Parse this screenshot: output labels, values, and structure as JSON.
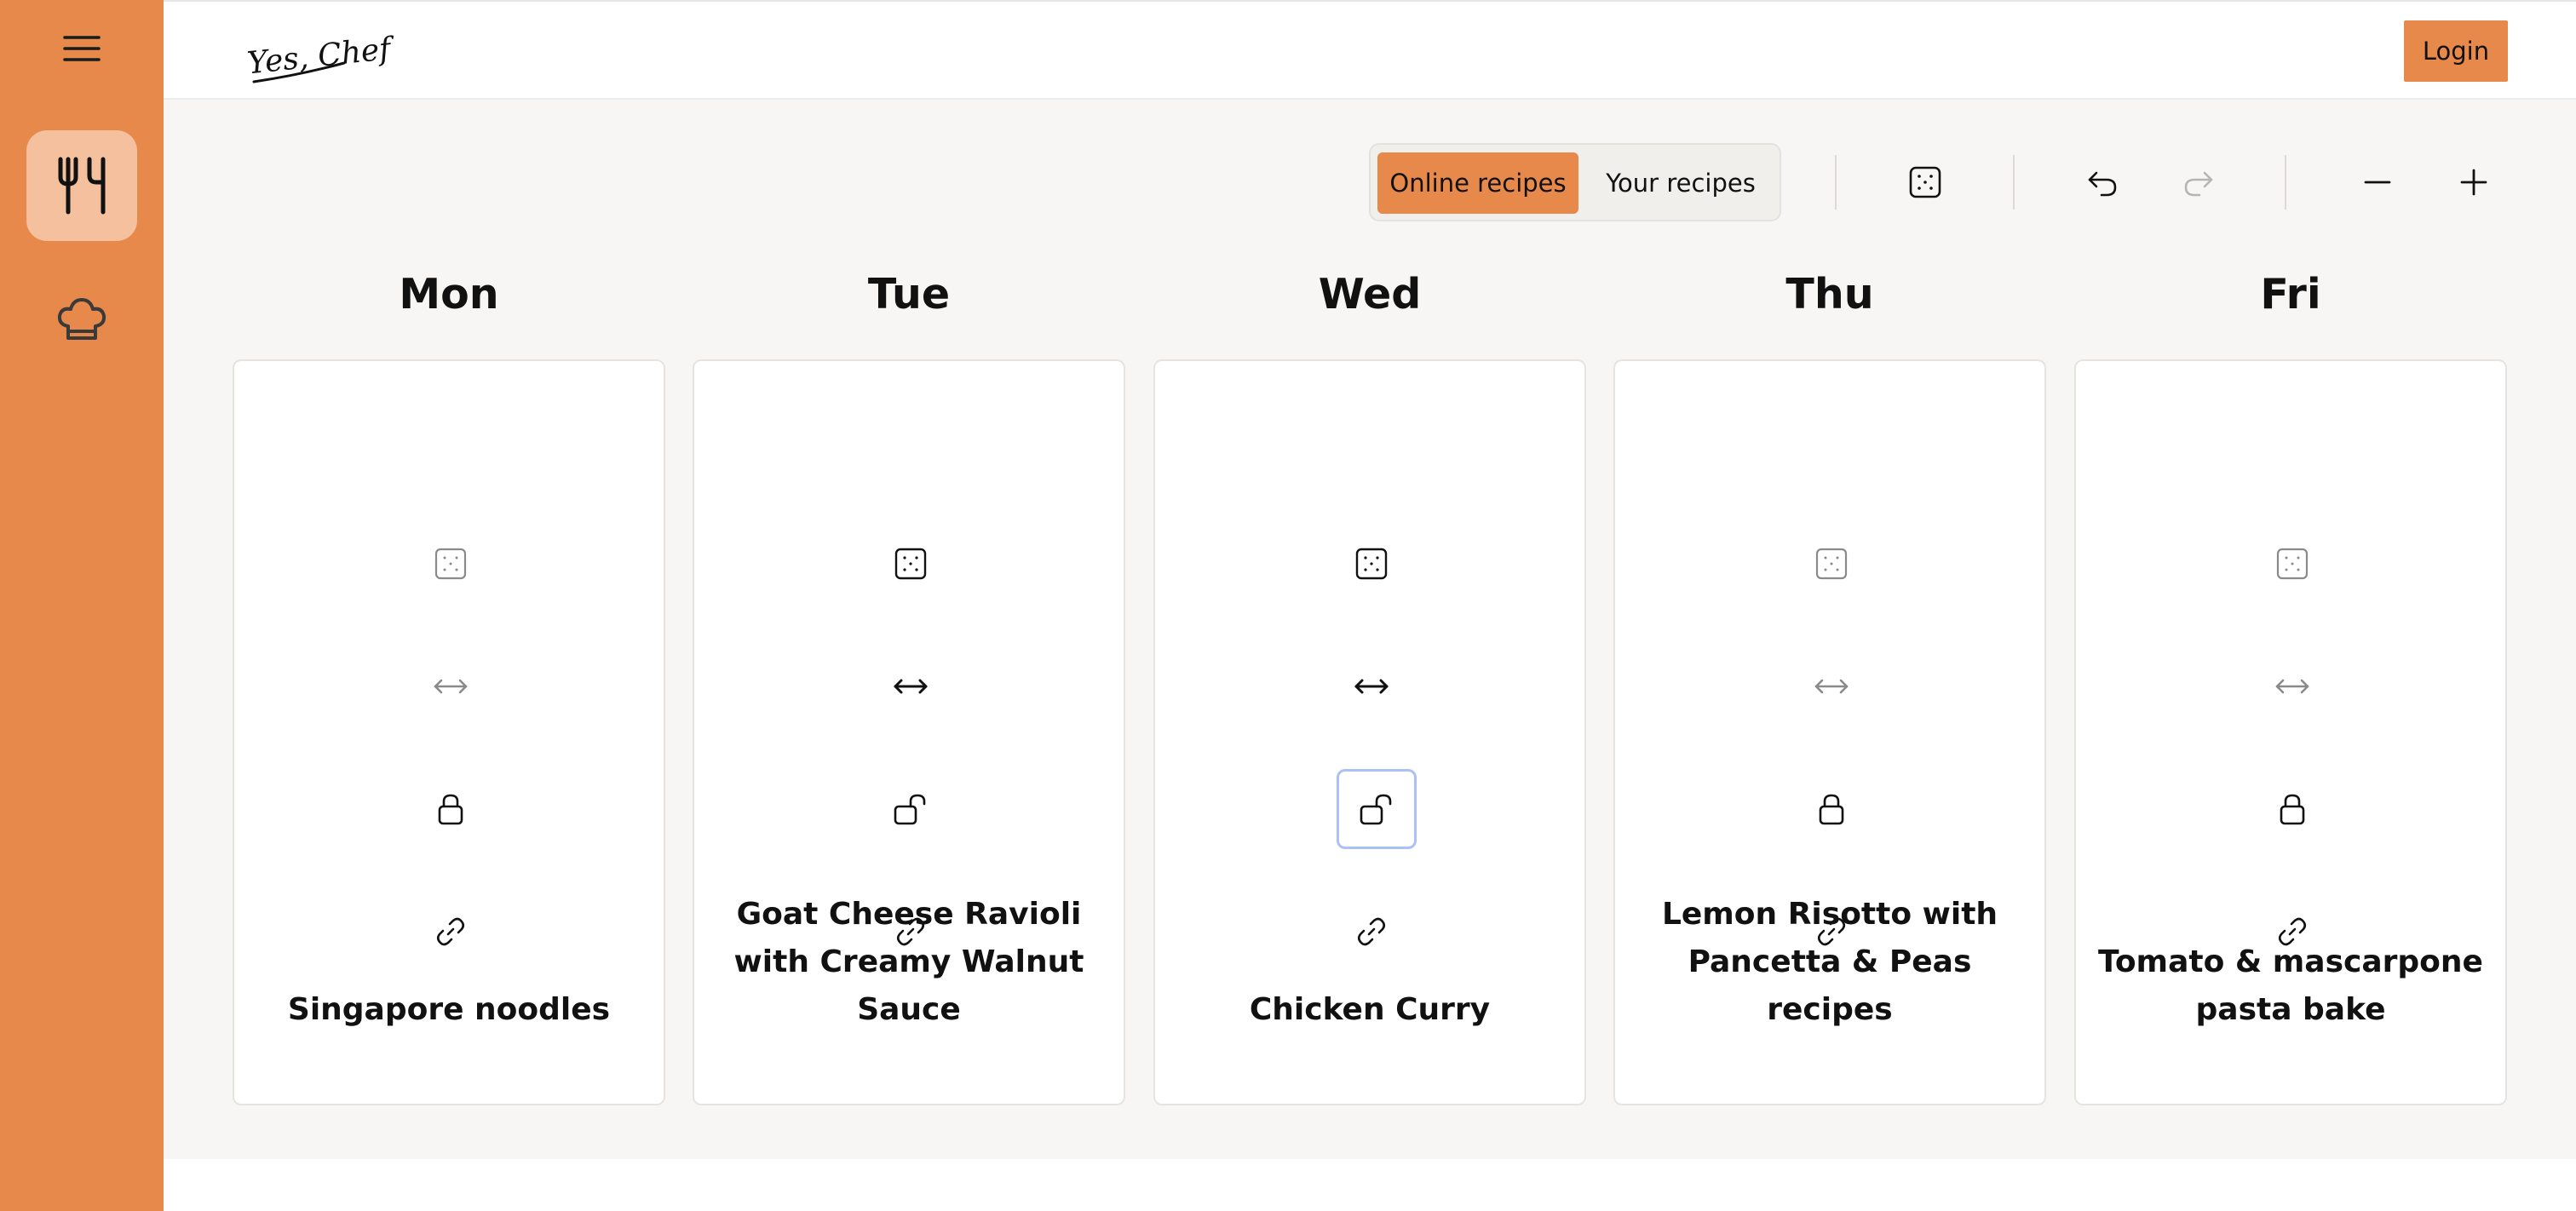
{
  "app": {
    "logo_text": "Yes, Chef!"
  },
  "header": {
    "login_label": "Login"
  },
  "sidebar": {
    "items": [
      {
        "name": "meal-plan",
        "icon": "fork-knife-icon",
        "active": true
      },
      {
        "name": "recipes",
        "icon": "chef-hat-icon",
        "active": false
      }
    ]
  },
  "toolbar": {
    "toggle": {
      "options": [
        "Online recipes",
        "Your recipes"
      ],
      "selected": "Online recipes"
    },
    "icons": [
      "dice-icon",
      "undo-icon",
      "redo-icon",
      "minus-icon",
      "plus-icon"
    ]
  },
  "colors": {
    "accent": "#e8894c",
    "accent_light": "#f4c09d",
    "background": "#f7f6f4",
    "focus_ring": "#a9c1f4"
  },
  "days": [
    {
      "label": "Mon",
      "recipe": "Singapore noodles",
      "locked": true
    },
    {
      "label": "Tue",
      "recipe": "Goat Cheese Ravioli with Creamy Walnut Sauce",
      "locked": false
    },
    {
      "label": "Wed",
      "recipe": "Chicken Curry",
      "locked": false,
      "focused_control": "lock"
    },
    {
      "label": "Thu",
      "recipe": "Lemon Risotto with Pancetta & Peas recipes",
      "locked": true
    },
    {
      "label": "Fri",
      "recipe": "Tomato & mascarpone pasta bake",
      "locked": true
    }
  ]
}
